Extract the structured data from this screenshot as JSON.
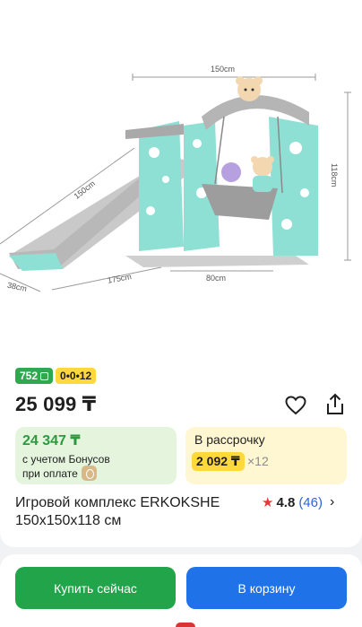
{
  "image": {
    "alt_icon": "playground-slide-swing-image",
    "dimensions": {
      "width": "150cm",
      "height": "118cm",
      "depth": "150cm",
      "slide_length": "175cm",
      "base_depth": "38cm",
      "swing_width": "80cm"
    }
  },
  "badges": {
    "bonus": "752",
    "installment": "0•0•12"
  },
  "price": "25 099 ₸",
  "bonus_offer": {
    "price": "24 347 ₸",
    "note_line1": "с учетом Бонусов",
    "note_line2": "при оплате"
  },
  "installment": {
    "title": "В рассрочку",
    "amount": "2 092 ₸",
    "months": "×12"
  },
  "product": {
    "title": "Игровой комплекс ERKOKSHE 150x150x118 см",
    "rating": "4.8",
    "reviews": "(46)"
  },
  "actions": {
    "buy_now": "Купить сейчас",
    "add_to_cart": "В корзину"
  },
  "colors": {
    "green": "#21a44a",
    "blue": "#1f72e8",
    "yellow": "#ffd83b",
    "rating_star": "#e53935"
  }
}
